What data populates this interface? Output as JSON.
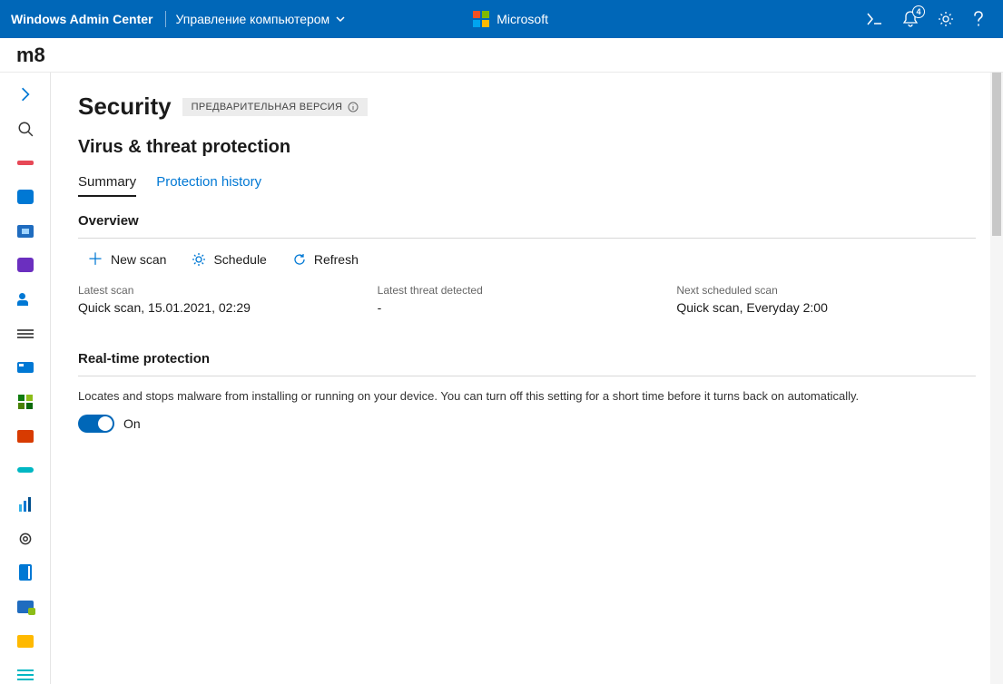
{
  "header": {
    "brand": "Windows Admin Center",
    "context": "Управление компьютером",
    "ms_text": "Microsoft",
    "notification_count": "4"
  },
  "machine": {
    "name": "m8"
  },
  "page": {
    "title": "Security",
    "preview_badge": "ПРЕДВАРИТЕЛЬНАЯ ВЕРСИЯ",
    "section_title": "Virus & threat protection"
  },
  "tabs": {
    "summary": "Summary",
    "history": "Protection history"
  },
  "overview": {
    "title": "Overview",
    "toolbar": {
      "new_scan": "New scan",
      "schedule": "Schedule",
      "refresh": "Refresh"
    },
    "cols": {
      "latest_scan_label": "Latest scan",
      "latest_scan_value": "Quick scan, 15.01.2021, 02:29",
      "latest_threat_label": "Latest threat detected",
      "latest_threat_value": "-",
      "next_scan_label": "Next scheduled scan",
      "next_scan_value": "Quick scan, Everyday 2:00"
    }
  },
  "realtime": {
    "title": "Real-time protection",
    "desc": "Locates and stops malware from installing or running on your device. You can turn off this setting for a short time before it turns back on automatically.",
    "state_label": "On"
  }
}
